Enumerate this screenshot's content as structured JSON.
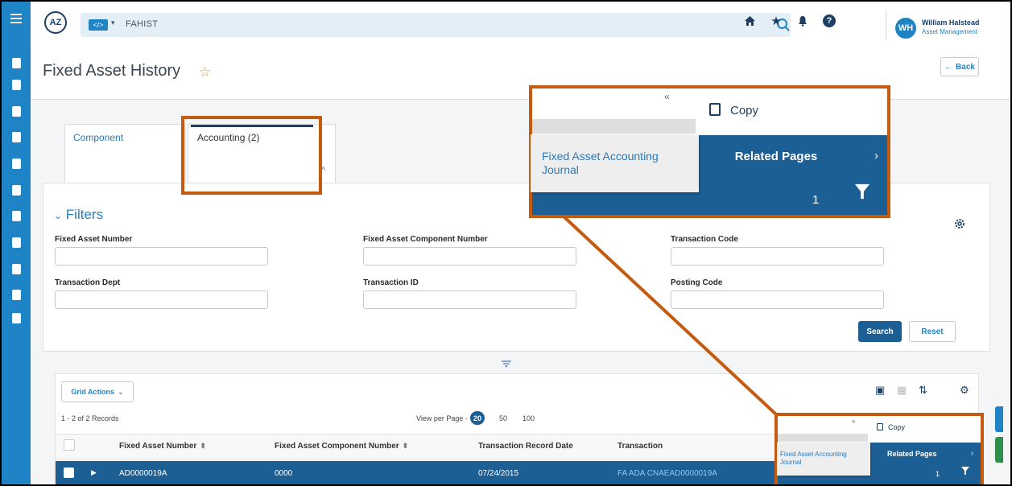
{
  "app": {
    "logo_text": "AZ",
    "app_code": "FAHIST",
    "switcher_label": "</>"
  },
  "user": {
    "initials": "WH",
    "name": "William Halstead",
    "role": "Asset Management"
  },
  "topbar_icons": [
    "search-icon",
    "home-icon",
    "star-icon",
    "bell-icon",
    "help-icon"
  ],
  "rail_icons": [
    "menu-icon",
    "org-icon",
    "search-doc-icon",
    "book-icon",
    "document-icon",
    "ledger-icon",
    "screen-icon",
    "report-icon",
    "transfer-icon",
    "file-icon",
    "asset-icon",
    "pages-icon"
  ],
  "page": {
    "title": "Fixed Asset History",
    "back_label": "Back"
  },
  "tabs": {
    "component": "Component",
    "accounting": "Accounting (2)"
  },
  "filters": {
    "toggle_label": "Filters",
    "fields": {
      "fixed_asset_number": "Fixed Asset Number",
      "fixed_asset_component_number": "Fixed Asset Component Number",
      "transaction_code": "Transaction Code",
      "transaction_dept": "Transaction Dept",
      "transaction_id": "Transaction ID",
      "posting_code": "Posting Code"
    },
    "search_label": "Search",
    "reset_label": "Reset"
  },
  "grid": {
    "actions_label": "Grid Actions",
    "records_label": "1 - 2 of 2 Records",
    "view_per_page_label": "View per Page -",
    "page_sizes": [
      "20",
      "50",
      "100"
    ],
    "active_page_size": "20",
    "columns": [
      "Fixed Asset Number",
      "Fixed Asset Component Number",
      "Transaction Record Date",
      "Transaction"
    ],
    "rows": [
      {
        "fixed_asset_number": "AD0000019A",
        "component_number": "0000",
        "record_date": "07/24/2015",
        "transaction": "FA ADA CNAEAD0000019A"
      }
    ]
  },
  "context_menu": {
    "copy_label": "Copy",
    "related_pages_label": "Related Pages",
    "related_item": "Fixed Asset Accounting Journal",
    "count_value": "1"
  },
  "colors": {
    "rail_blue": "#1f84c5",
    "navy": "#1c5f94",
    "highlight_orange": "#c55a11",
    "link_blue": "#2b79ba"
  }
}
